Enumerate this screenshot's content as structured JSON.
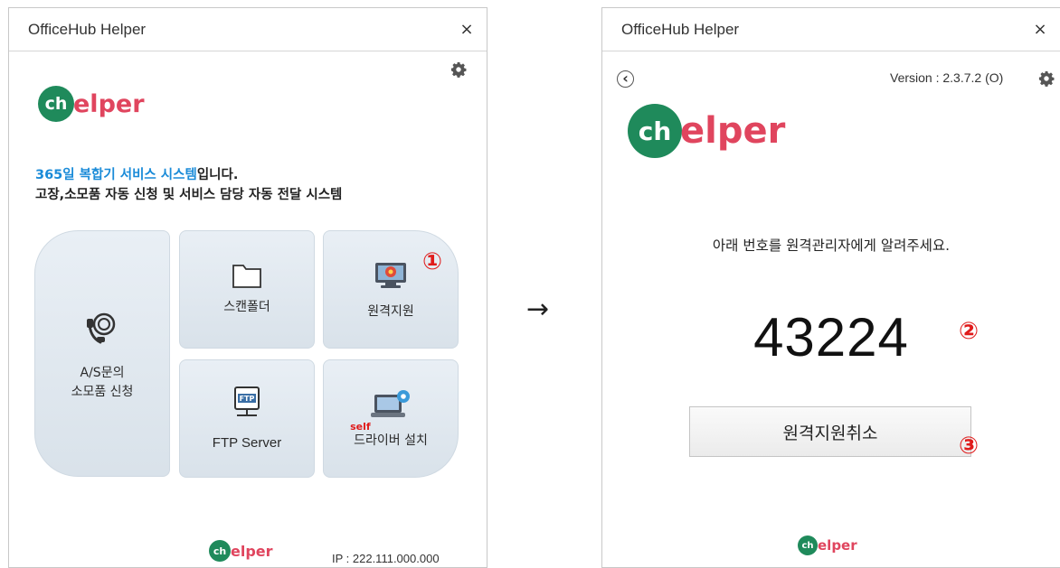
{
  "left_window": {
    "title": "OfficeHub Helper",
    "close_label": "×",
    "logo": {
      "mark": "ch",
      "word": "elper"
    },
    "intro": {
      "highlight": "365일 복합기 서비스 시스템",
      "line1_rest": "입니다.",
      "line2": "고장,소모품 자동 신청 및 서비스 담당 자동 전달 시스템"
    },
    "tiles": {
      "as_request": {
        "line1": "A/S문의",
        "line2": "소모품 신청"
      },
      "scan_folder": {
        "label": "스캔폴더"
      },
      "remote_support": {
        "label": "원격지원"
      },
      "ftp_server": {
        "label": "FTP Server",
        "icon_text": "FTP"
      },
      "driver_install": {
        "label": "드라이버 설치",
        "prefix": "self"
      }
    },
    "footer_logo": {
      "mark": "ch",
      "word": "elper"
    },
    "ip_text": "IP : 222.111.000.000",
    "callout_1": "①"
  },
  "arrow": "→",
  "right_window": {
    "title": "OfficeHub Helper",
    "close_label": "×",
    "back_icon": "‹",
    "version_text": "Version : 2.3.7.2 (O)",
    "logo": {
      "mark": "ch",
      "word": "elper"
    },
    "instruction": "아래 번호를 원격관리자에게 알려주세요.",
    "code": "43224",
    "cancel_label": "원격지원취소",
    "footer_logo": {
      "mark": "ch",
      "word": "elper"
    },
    "callout_2": "②",
    "callout_3": "③"
  },
  "colors": {
    "brand_green": "#1f8a5b",
    "brand_pink": "#e0455e",
    "highlight_blue": "#1a8bd8",
    "callout_red": "#e01b1b"
  }
}
